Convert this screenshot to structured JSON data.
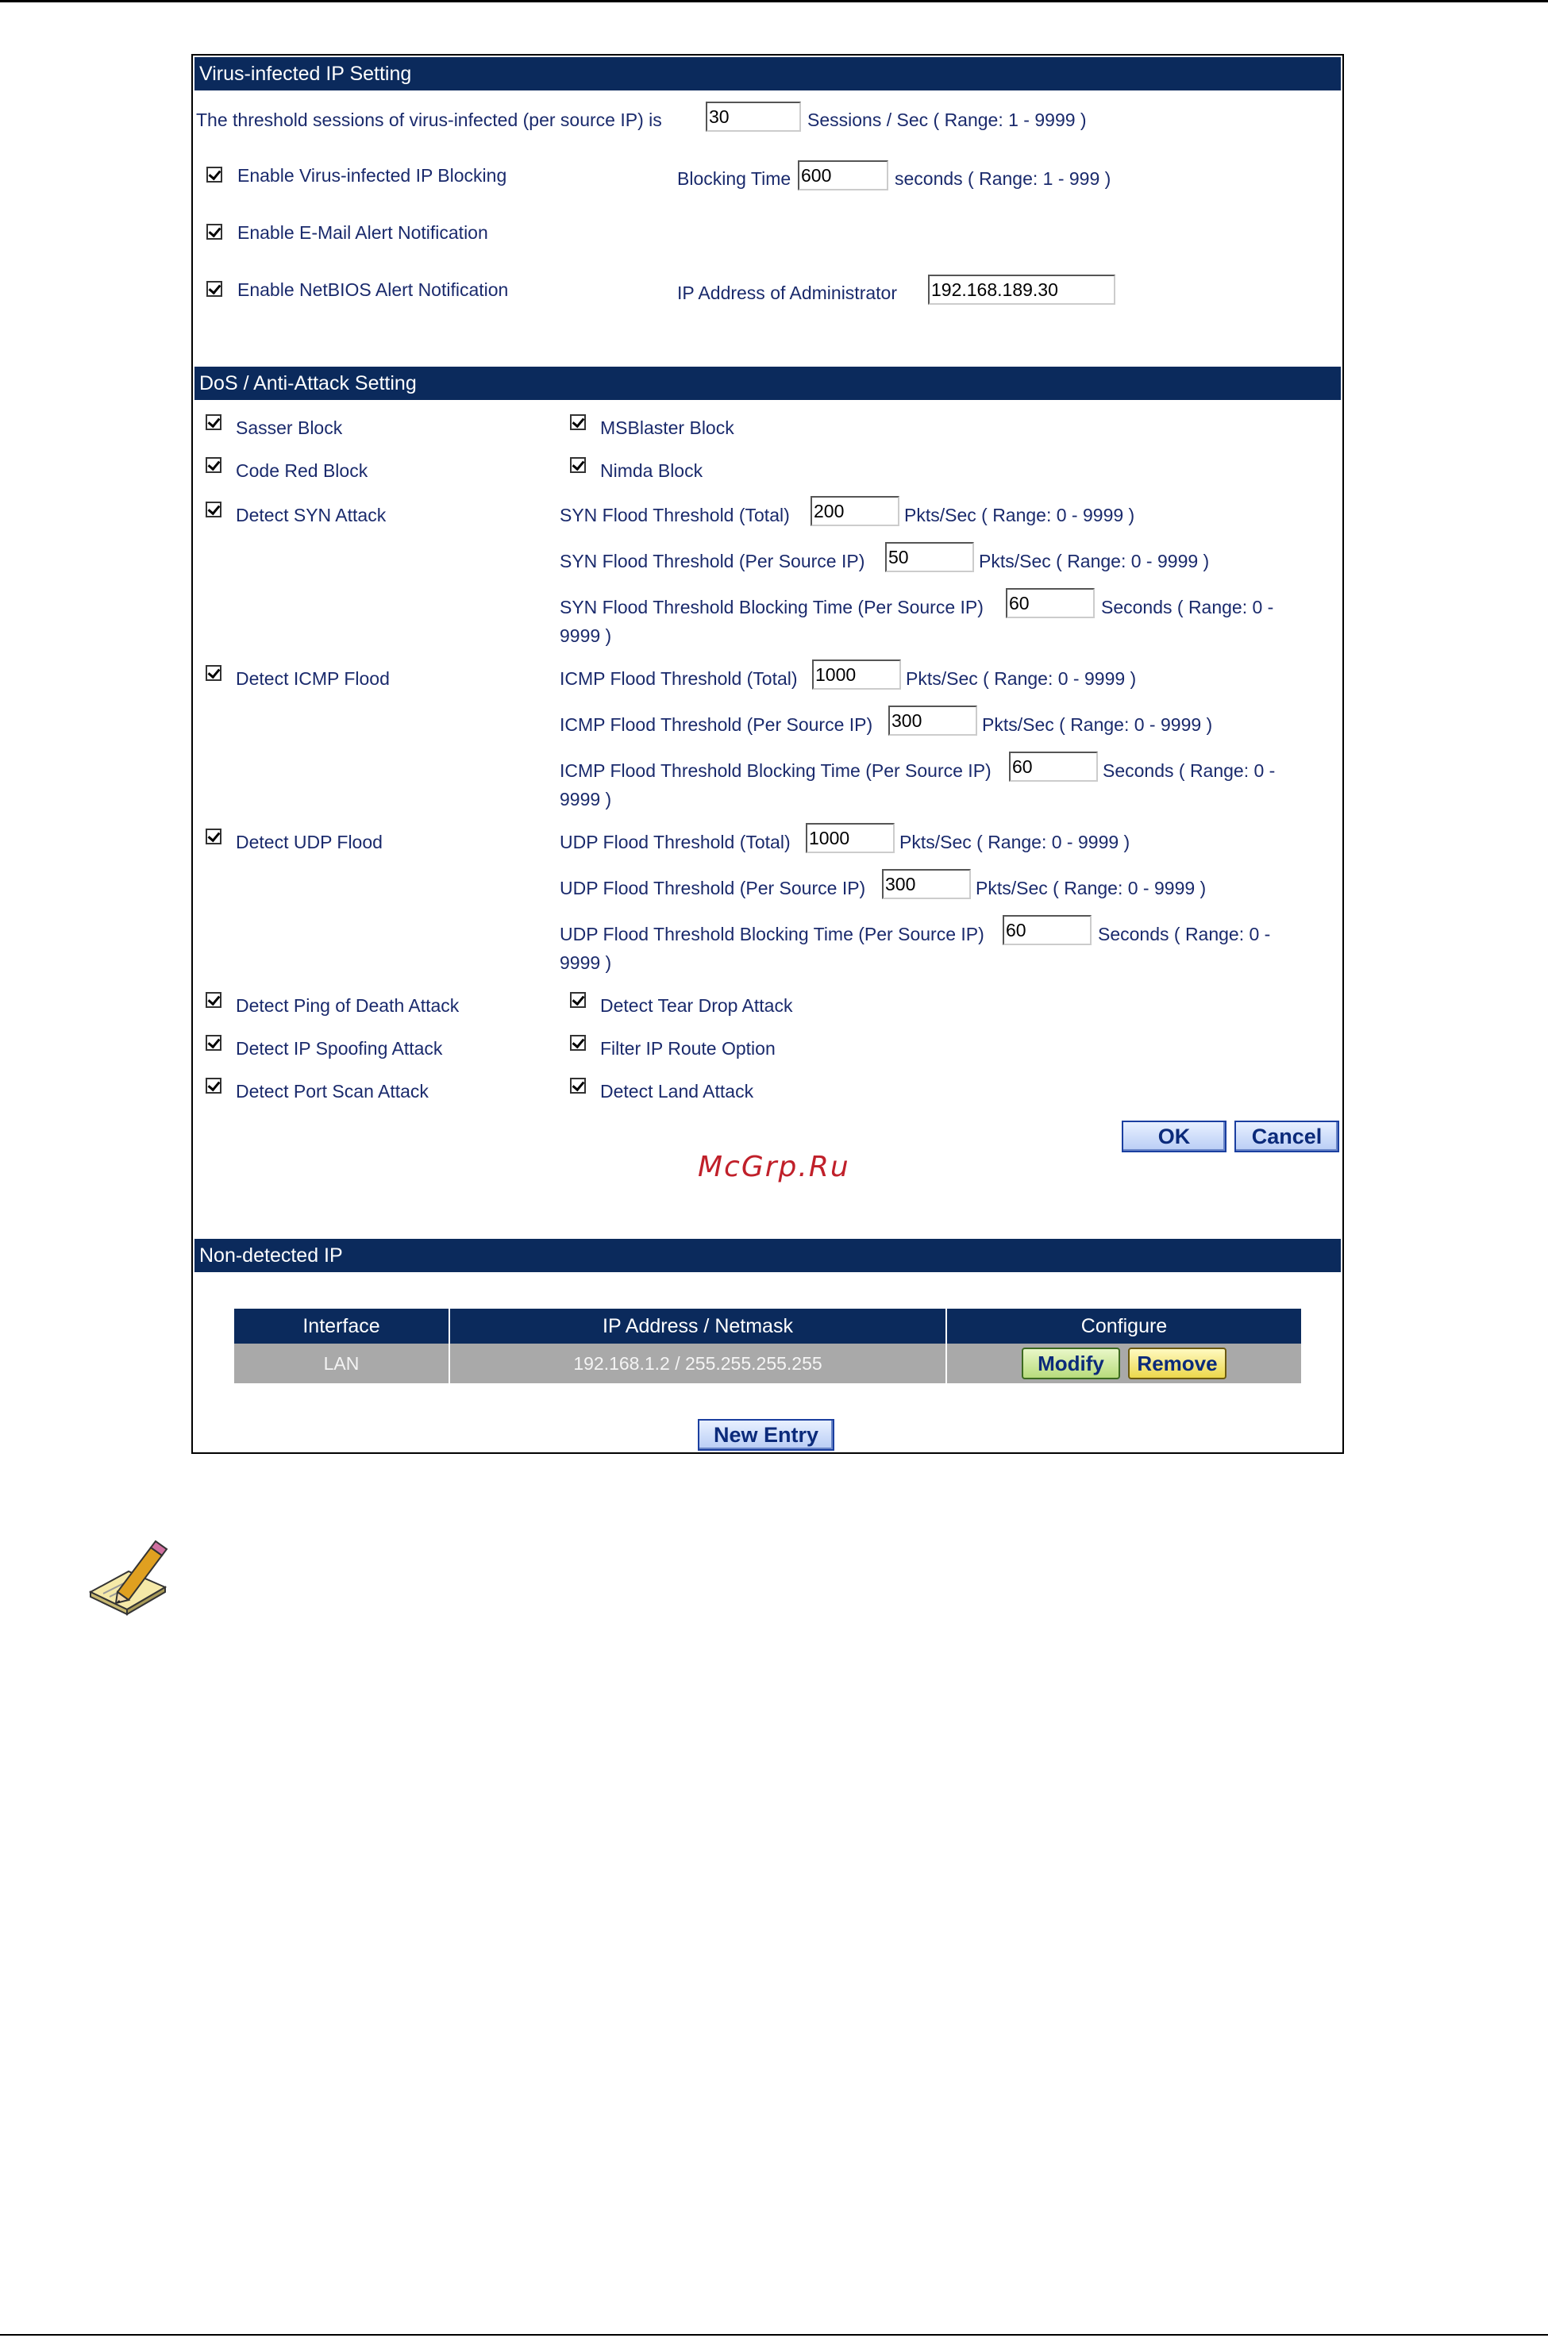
{
  "virus_section": {
    "title": "Virus-infected IP Setting",
    "threshold_label": "The threshold sessions of virus-infected (per source IP) is",
    "threshold_value": "30",
    "threshold_unit": "Sessions / Sec  ( Range: 1 - 9999 )",
    "enable_blocking_label": "Enable Virus-infected IP Blocking",
    "blocking_time_label": "Blocking Time",
    "blocking_time_value": "600",
    "blocking_time_unit": "seconds  ( Range: 1 - 999 )",
    "email_alert_label": "Enable E-Mail Alert Notification",
    "netbios_alert_label": "Enable NetBIOS Alert Notification",
    "admin_ip_label": "IP Address of Administrator",
    "admin_ip_value": "192.168.189.30"
  },
  "dos_section": {
    "title": "DoS / Anti-Attack Setting",
    "sasser": "Sasser Block",
    "msblaster": "MSBlaster Block",
    "codered": "Code Red Block",
    "nimda": "Nimda Block",
    "syn": {
      "label": "Detect SYN Attack",
      "total_label": "SYN Flood Threshold (Total)",
      "total_value": "200",
      "total_unit": "Pkts/Sec  ( Range: 0 - 9999 )",
      "per_label": "SYN Flood Threshold (Per Source IP)",
      "per_value": "50",
      "per_unit": "Pkts/Sec  ( Range: 0 - 9999 )",
      "block_label": "SYN Flood Threshold Blocking Time (Per Source IP)",
      "block_value": "60",
      "block_unit": "Seconds  ( Range: 0 -",
      "block_unit_cont": "9999 )"
    },
    "icmp": {
      "label": "Detect ICMP Flood",
      "total_label": "ICMP Flood Threshold (Total)",
      "total_value": "1000",
      "total_unit": "Pkts/Sec  ( Range: 0 - 9999 )",
      "per_label": "ICMP Flood Threshold (Per Source IP)",
      "per_value": "300",
      "per_unit": "Pkts/Sec  ( Range: 0 - 9999 )",
      "block_label": "ICMP Flood Threshold Blocking Time (Per Source IP)",
      "block_value": "60",
      "block_unit": "Seconds  ( Range: 0 -",
      "block_unit_cont": "9999 )"
    },
    "udp": {
      "label": "Detect UDP Flood",
      "total_label": "UDP Flood Threshold (Total)",
      "total_value": "1000",
      "total_unit": "Pkts/Sec  ( Range: 0 - 9999 )",
      "per_label": "UDP Flood Threshold (Per Source IP)",
      "per_value": "300",
      "per_unit": "Pkts/Sec  ( Range: 0 - 9999 )",
      "block_label": "UDP Flood Threshold Blocking Time (Per Source IP)",
      "block_value": "60",
      "block_unit": "Seconds  ( Range: 0 -",
      "block_unit_cont": "9999 )"
    },
    "ping_of_death": "Detect Ping of Death Attack",
    "tear_drop": "Detect Tear Drop Attack",
    "ip_spoofing": "Detect IP Spoofing Attack",
    "filter_ip_route": "Filter IP Route Option",
    "port_scan": "Detect Port Scan Attack",
    "land_attack": "Detect Land Attack",
    "ok_label": "OK",
    "cancel_label": "Cancel"
  },
  "watermark": "McGrp.Ru",
  "nondetected_section": {
    "title": "Non-detected IP",
    "columns": [
      "Interface",
      "IP Address / Netmask",
      "Configure"
    ],
    "rows": [
      {
        "interface": "LAN",
        "ip_netmask": "192.168.1.2 / 255.255.255.255",
        "modify_label": "Modify",
        "remove_label": "Remove"
      }
    ],
    "new_entry_label": "New Entry"
  },
  "icons": {
    "note": "pencil-note-icon",
    "checkbox": "checkmark-icon"
  },
  "colors": {
    "header_bg": "#0b2a5c",
    "text": "#1a2a6c",
    "row_bg": "#a9a9a9",
    "watermark": "#c0202a"
  }
}
